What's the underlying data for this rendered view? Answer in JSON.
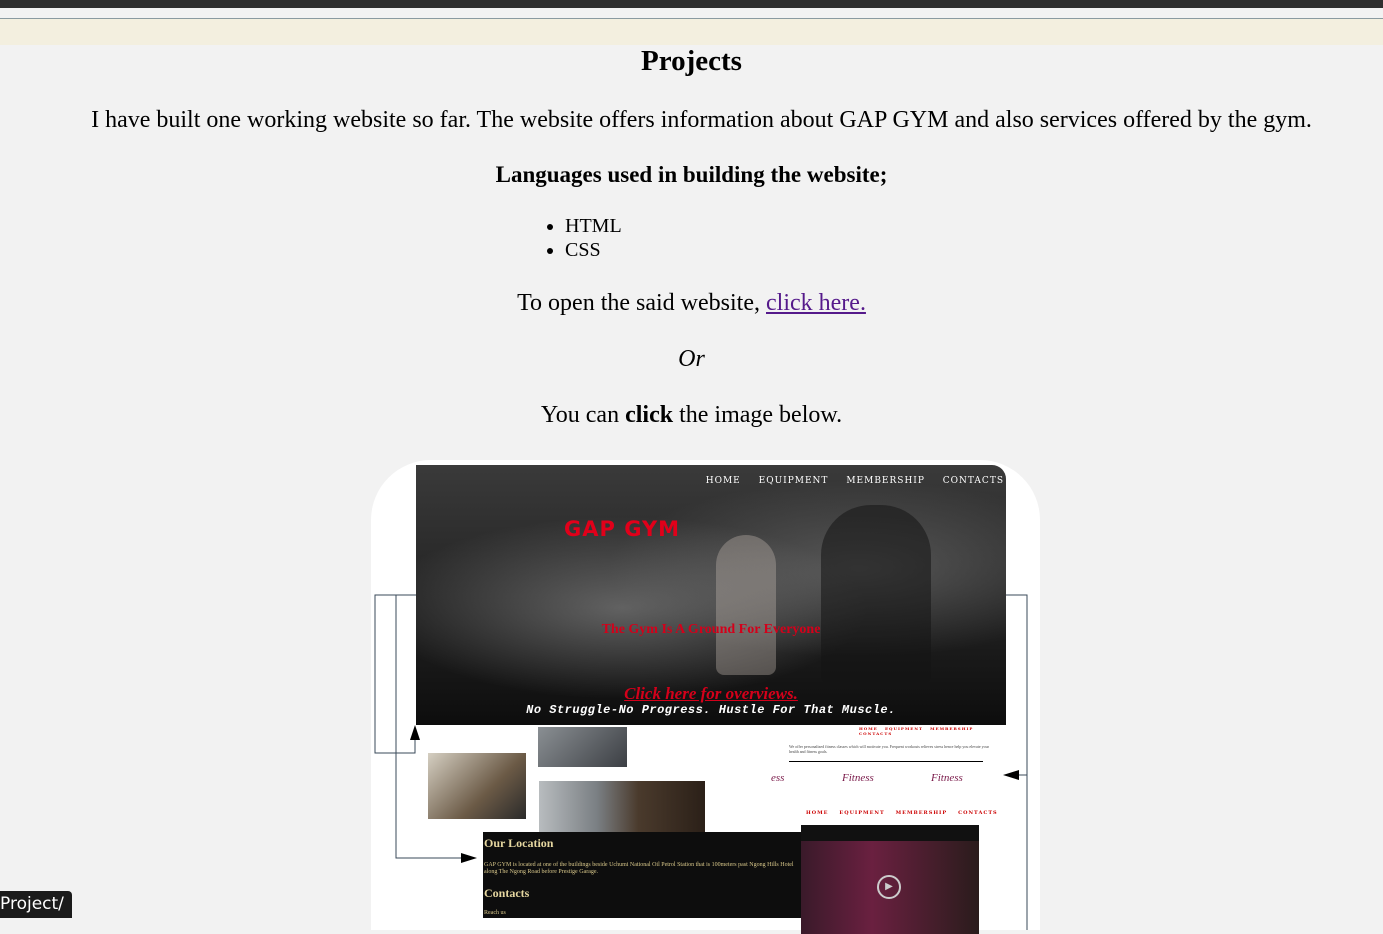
{
  "section": {
    "title": "Projects",
    "intro": "I have built one working website so far. The website offers information about GAP GYM and also services offered by the gym.",
    "languages_heading": "Languages used in building the website;",
    "languages": [
      "HTML",
      "CSS"
    ],
    "open_prefix": "To open the said website,",
    "open_link": "click here.",
    "or_text": "Or",
    "click_prefix": "You can",
    "click_bold": "click",
    "click_suffix": "the image below."
  },
  "preview": {
    "nav": [
      "HOME",
      "EQUIPMENT",
      "MEMBERSHIP",
      "CONTACTS"
    ],
    "brand": "GAP GYM",
    "tagline": "The Gym Is A Ground For Everyone",
    "overview_link": "Click here for overviews.",
    "motto": "No Struggle-No Progress. Hustle For That Muscle.",
    "location_heading": "Our Location",
    "location_text": "GAP GYM is located at one of the buildings beside Uchumi National Oil Petrol Station that is 100meters past Ngong Hills Hotel along The Ngong Road before Prestige Garage.",
    "contacts_heading": "Contacts",
    "contacts_text": "Reach us",
    "fitness_label": "Fitness",
    "fitness_partial": "ess",
    "right_text": "We offer personalized fitness classes which will motivate you. Frequent workouts relieves stress hence help you elevate your health and fitness goals.",
    "right_nav": [
      "HOME",
      "EQUIPMENT",
      "MEMBERSHIP",
      "CONTACTS"
    ]
  },
  "status_bar": {
    "text": "Project/"
  },
  "colors": {
    "link": "#551a8b",
    "brand_red": "#e1001a",
    "status_bg": "#1b1b1b"
  }
}
